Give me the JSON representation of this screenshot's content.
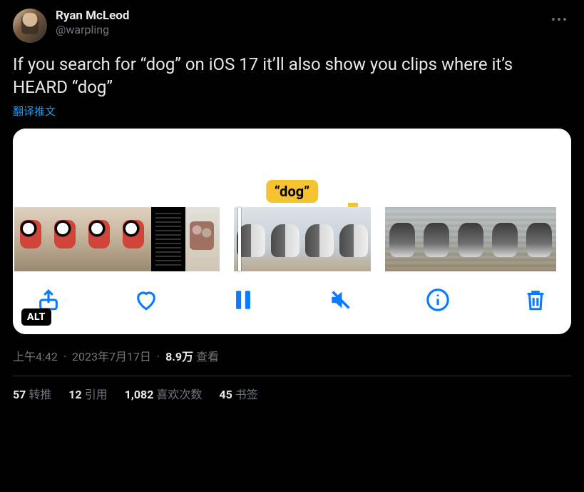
{
  "author": {
    "display_name": "Ryan McLeod",
    "handle": "@warpling"
  },
  "tweet_text": "If you search for “dog” on iOS 17 it’ll also show you clips where it’s HEARD “dog”",
  "translate_label": "翻译推文",
  "media": {
    "caption_tag": "“dog”",
    "alt_badge": "ALT",
    "toolbar": {
      "share": "share",
      "like": "like",
      "pause": "pause",
      "mute": "mute",
      "info": "info",
      "delete": "delete"
    }
  },
  "timestamp": {
    "time": "上午4:42",
    "date": "2023年7月17日",
    "views_value": "8.9万",
    "views_label": "查看"
  },
  "stats": {
    "retweets": {
      "value": "57",
      "label": "转推"
    },
    "quotes": {
      "value": "12",
      "label": "引用"
    },
    "likes": {
      "value": "1,082",
      "label": "喜欢次数"
    },
    "bookmarks": {
      "value": "45",
      "label": "书签"
    }
  }
}
